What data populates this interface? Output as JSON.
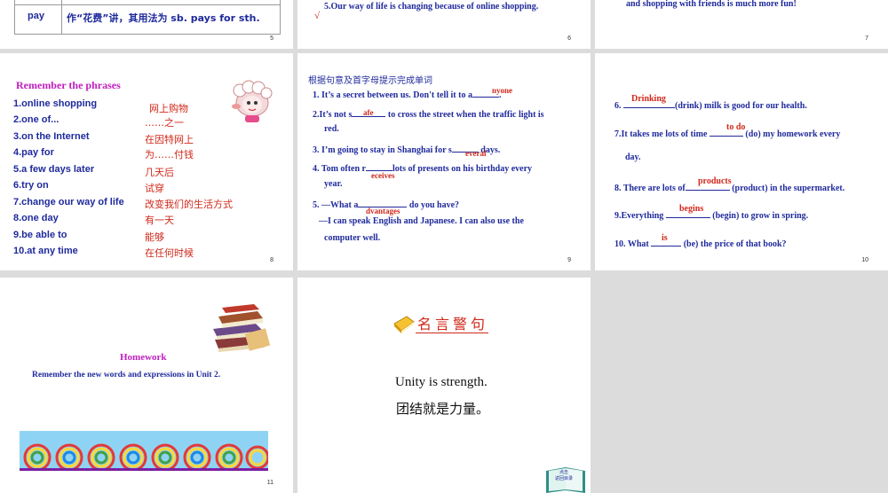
{
  "slide5": {
    "word": "pay",
    "note": "作“花费”讲，其用法为 sb. pays for sth.",
    "page": "5"
  },
  "slide6": {
    "line": "5.Our way of life is changing because of online shopping.",
    "mark": "√",
    "page": "6"
  },
  "slide7": {
    "line": "and shopping with friends is much more fun!",
    "page": "7"
  },
  "slide8": {
    "title": "Remember the phrases",
    "items": [
      {
        "en": "1.online shopping",
        "zh": "网上购物"
      },
      {
        "en": "2.one of...",
        "zh": "……之一"
      },
      {
        "en": "3.on the Internet",
        "zh": "在因特网上"
      },
      {
        "en": "4.pay for",
        "zh": "为……付钱"
      },
      {
        "en": "5.a few days later",
        "zh": "几天后"
      },
      {
        "en": "6.try on",
        "zh": "试穿"
      },
      {
        "en": "7.change our way of life",
        "zh": "改变我们的生活方式"
      },
      {
        "en": "8.one day",
        "zh": "有一天"
      },
      {
        "en": "9.be able to",
        "zh": "能够"
      },
      {
        "en": "10.at any time",
        "zh": "在任何时候"
      }
    ],
    "page": "8"
  },
  "slide9": {
    "instruction": "根据句意及首字母提示完成单词",
    "q1_a": "1. It’s a secret between us. Don't tell it to a",
    "q1_ans": "nyone",
    "q2_a": "2.It’s not s",
    "q2_ans": "afe",
    "q2_b": "to cross the street when the traffic light is",
    "q2_c": "red.",
    "q3_a": "3. I’m going to stay in Shanghai for s",
    "q3_ans": "everal",
    "q3_b": "days.",
    "q4_a": "4. Tom often r",
    "q4_ans": "eceives",
    "q4_b": "lots of presents on his birthday every",
    "q4_c": "year.",
    "q5_a": "5. —What a",
    "q5_ans": "dvantages",
    "q5_b": "do you have?",
    "q5_c": "—I can speak English and Japanese. I can also use the",
    "q5_d": "computer well.",
    "page": "9"
  },
  "slide10": {
    "q6_a": "6.",
    "q6_ans": "Drinking",
    "q6_b": "(drink) milk is good for our health.",
    "q7_a": "7.It takes me lots of time",
    "q7_ans": "to do",
    "q7_b": "(do) my homework every",
    "q7_c": "day.",
    "q8_a": "8. There are lots of",
    "q8_ans": "products",
    "q8_b": "(product) in the supermarket.",
    "q9_a": "9.Everything",
    "q9_ans": "begins",
    "q9_b": "(begin) to grow in spring.",
    "q10_a": "10. What",
    "q10_ans": "is",
    "q10_b": "(be) the price of that book?",
    "page": "10"
  },
  "slide11": {
    "title": "Homework",
    "text": "Remember the new words and expressions in Unit 2.",
    "page": "11"
  },
  "slide12": {
    "heading": "名言警句",
    "quote_en": "Unity is strength.",
    "quote_zh": "团结就是力量。",
    "book_label1": "点击",
    "book_label2": "返回目录"
  },
  "colors": {
    "navy": "#1f2a9c",
    "red": "#d0281a",
    "magenta": "#c01ec0",
    "background": "#dcdcdc"
  }
}
